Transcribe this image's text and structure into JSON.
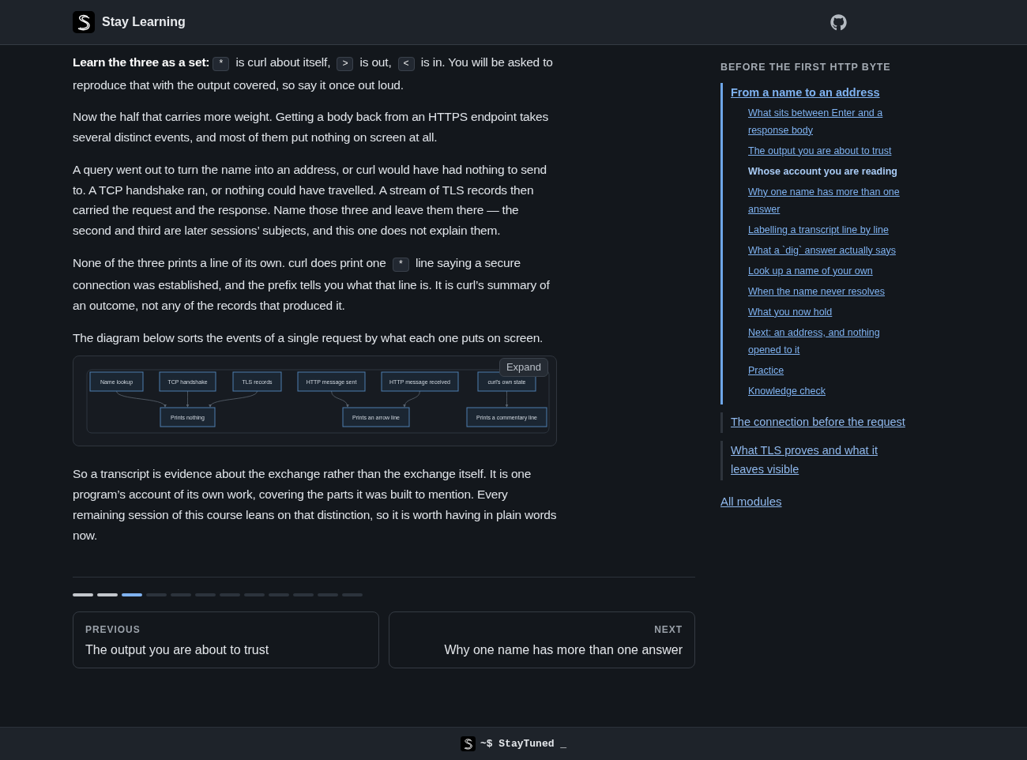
{
  "header": {
    "brand": "Stay Learning"
  },
  "article": {
    "paragraphs": [
      [
        {
          "kind": "bold",
          "text": "Learn the three as a set:"
        },
        {
          "kind": "code",
          "text": "*"
        },
        {
          "kind": "text",
          "text": " is curl about itself, "
        },
        {
          "kind": "code",
          "text": ">"
        },
        {
          "kind": "text",
          "text": " is out, "
        },
        {
          "kind": "code",
          "text": "<"
        },
        {
          "kind": "text",
          "text": " is in. You will be asked to reproduce that with the output covered, so say it once out loud."
        }
      ],
      [
        {
          "kind": "text",
          "text": "Now the half that carries more weight. Getting a body back from an HTTPS endpoint takes several distinct events, and most of them put nothing on screen at all."
        }
      ],
      [
        {
          "kind": "text",
          "text": "A query went out to turn the name into an address, or curl would have had nothing to send to. A TCP handshake ran, or nothing could have travelled. A stream of TLS records then carried the request and the response. Name those three and leave them there — the second and third are later sessions’ subjects, and this one does not explain them."
        }
      ],
      [
        {
          "kind": "text",
          "text": "None of the three prints a line of its own. curl does print one "
        },
        {
          "kind": "code",
          "text": "*"
        },
        {
          "kind": "text",
          "text": " line saying a secure connection was established, and the prefix tells you what that line is. It is curl’s summary of an outcome, not any of the records that produced it."
        }
      ],
      [
        {
          "kind": "text",
          "text": "The diagram below sorts the events of a single request by what each one puts on screen."
        }
      ]
    ],
    "diagram": {
      "expand_label": "Expand",
      "groups": [
        {
          "events": [
            "Name lookup",
            "TCP handshake",
            "TLS records"
          ],
          "outcome": "Prints nothing"
        },
        {
          "events": [
            "HTTP message sent",
            "HTTP message received"
          ],
          "outcome": "Prints an arrow line"
        },
        {
          "events": [
            "curl's own state"
          ],
          "outcome": "Prints a commentary line"
        }
      ]
    },
    "closing": "So a transcript is evidence about the exchange rather than the exchange itself. It is one program’s account of its own work, covering the parts it was built to mention. Every remaining session of this course leans on that distinction, so it is worth having in plain words now."
  },
  "progress": [
    {
      "kind": "done"
    },
    {
      "kind": "done"
    },
    {
      "kind": "current"
    },
    {
      "kind": "todo"
    },
    {
      "kind": "todo"
    },
    {
      "kind": "todo"
    },
    {
      "kind": "todo"
    },
    {
      "kind": "todo"
    },
    {
      "kind": "todo"
    },
    {
      "kind": "todo"
    },
    {
      "kind": "todo"
    },
    {
      "kind": "todo"
    }
  ],
  "pager": {
    "previous": {
      "label": "PREVIOUS",
      "title": "The output you are about to trust"
    },
    "next": {
      "label": "NEXT",
      "title": "Why one name has more than one answer"
    }
  },
  "sidebar": {
    "heading": "BEFORE THE FIRST HTTP BYTE",
    "modules": [
      {
        "title": "From a name to an address",
        "selected": true,
        "children": [
          {
            "title": "What sits between Enter and a response body",
            "selected": false
          },
          {
            "title": "The output you are about to trust",
            "selected": false
          },
          {
            "title": "Whose account you are reading",
            "selected": true
          },
          {
            "title": "Why one name has more than one answer",
            "selected": false
          },
          {
            "title": "Labelling a transcript line by line",
            "selected": false
          },
          {
            "title": "What a `dig` answer actually says",
            "selected": false
          },
          {
            "title": "Look up a name of your own",
            "selected": false
          },
          {
            "title": "When the name never resolves",
            "selected": false
          },
          {
            "title": "What you now hold",
            "selected": false
          },
          {
            "title": "Next: an address, and nothing opened to it",
            "selected": false
          },
          {
            "title": "Practice",
            "selected": false
          },
          {
            "title": "Knowledge check",
            "selected": false
          }
        ]
      },
      {
        "title": "The connection before the request",
        "selected": false
      },
      {
        "title": "What TLS proves and what it leaves visible",
        "selected": false
      }
    ],
    "all_link": "All modules"
  },
  "footer": {
    "prompt": "~$ StayTuned _"
  }
}
